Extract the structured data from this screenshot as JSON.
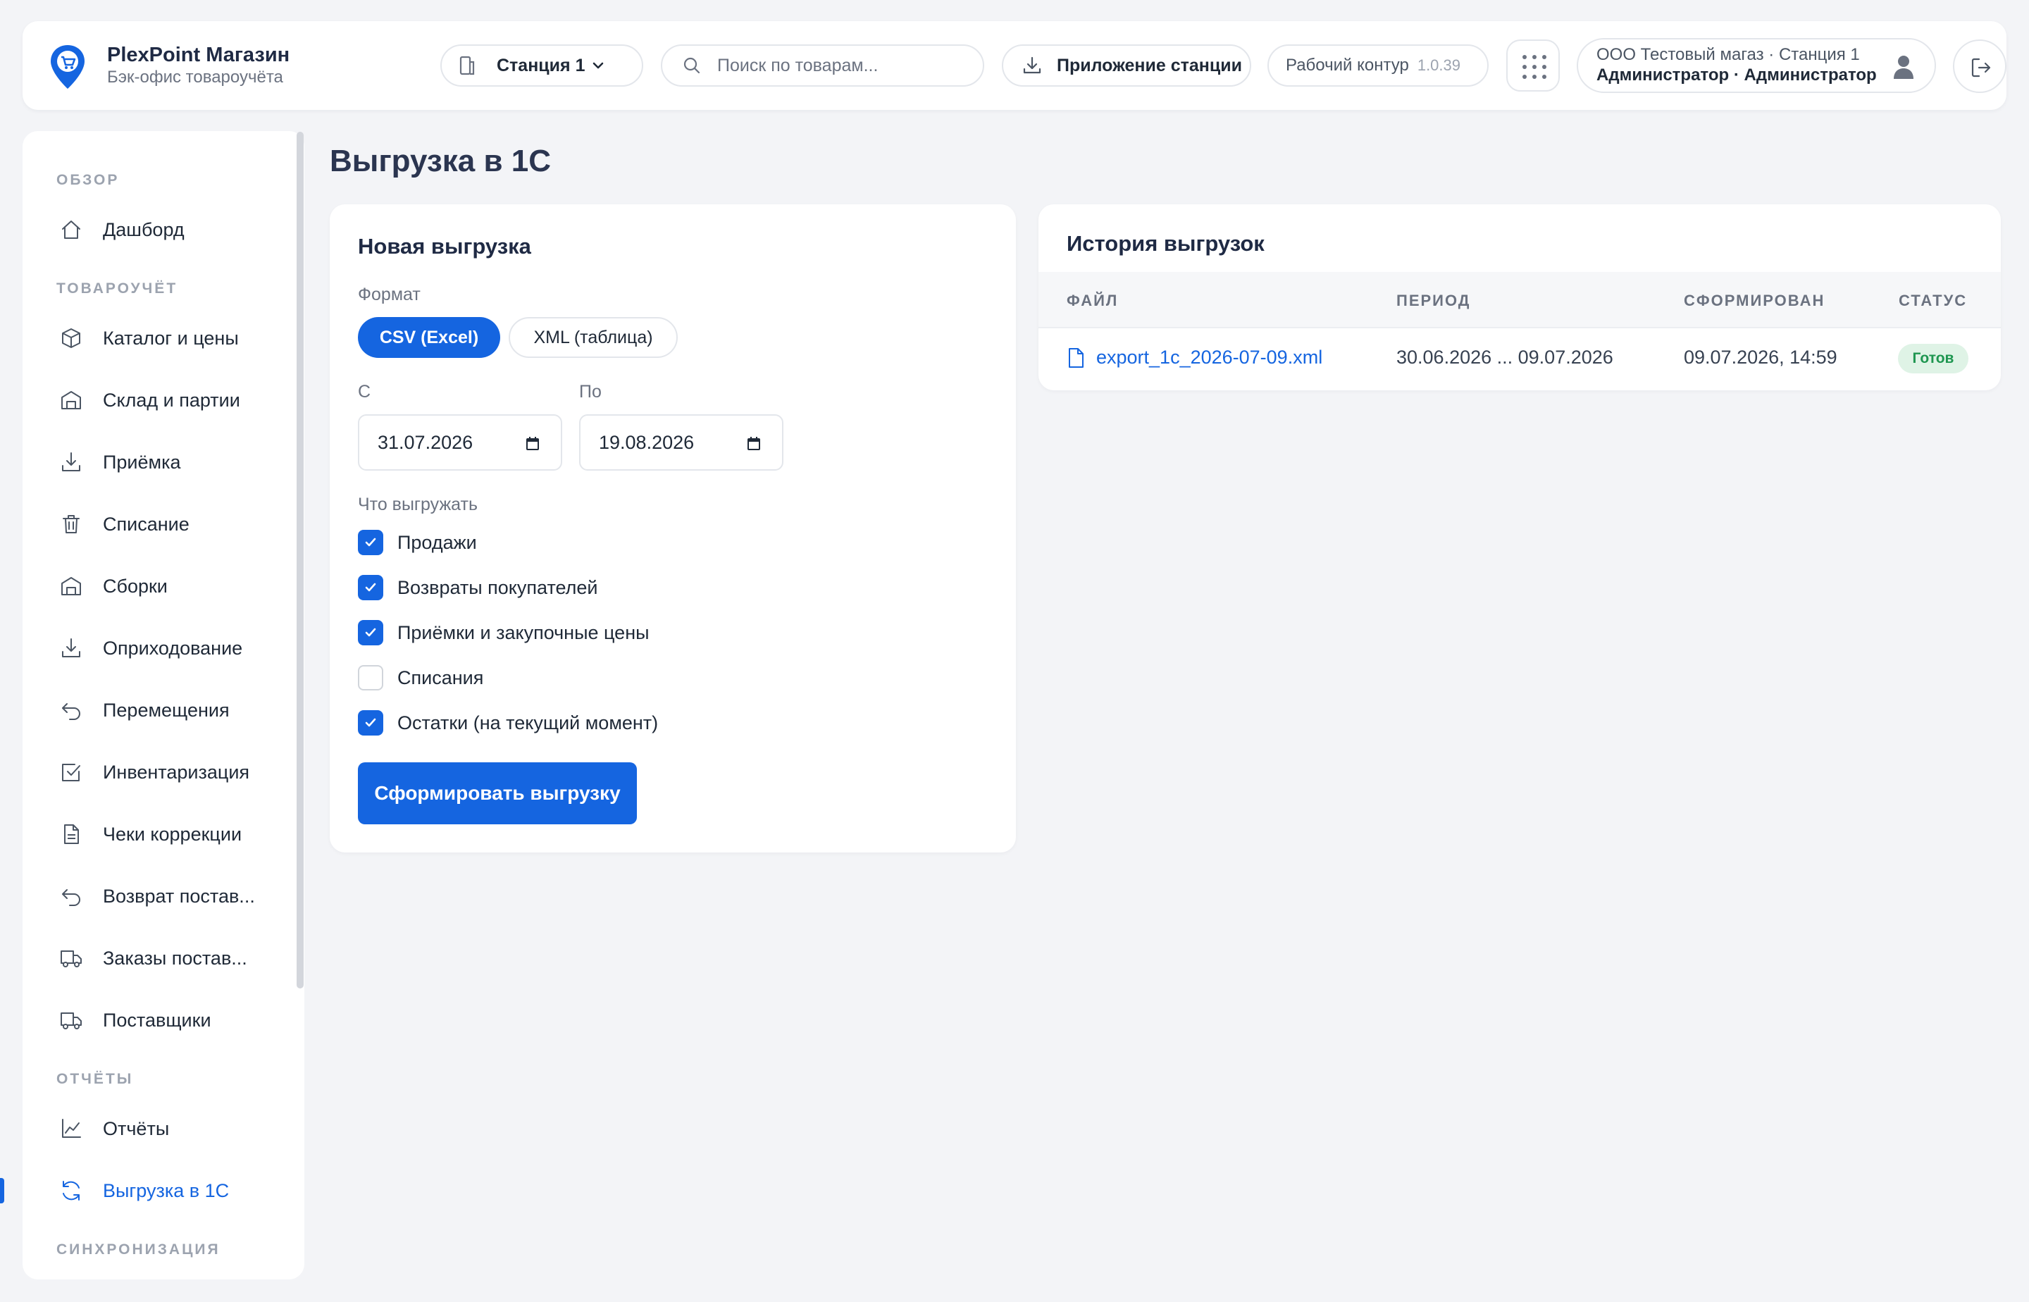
{
  "header": {
    "brand_name": "PlexPoint Магазин",
    "brand_subtitle": "Бэк-офис товароучёта",
    "station_label": "Станция 1",
    "search_placeholder": "Поиск по товарам...",
    "app_button_label": "Приложение станции",
    "env_label": "Рабочий контур",
    "env_version": "1.0.39",
    "user_org_line": "ООО Тестовый магаз · Станция 1",
    "user_role_line": "Администратор · Администратор"
  },
  "sidebar": {
    "sections": {
      "overview": "ОБЗОР",
      "inventory": "ТОВАРОУЧЁТ",
      "reports": "ОТЧЁТЫ",
      "sync": "СИНХРОНИЗАЦИЯ"
    },
    "items": [
      {
        "label": "Дашборд",
        "icon": "home-icon"
      },
      {
        "label": "Каталог и цены",
        "icon": "box-icon"
      },
      {
        "label": "Склад и партии",
        "icon": "warehouse-icon"
      },
      {
        "label": "Приёмка",
        "icon": "download-icon"
      },
      {
        "label": "Списание",
        "icon": "trash-icon"
      },
      {
        "label": "Сборки",
        "icon": "warehouse-icon"
      },
      {
        "label": "Оприходование",
        "icon": "download-icon"
      },
      {
        "label": "Перемещения",
        "icon": "undo-icon"
      },
      {
        "label": "Инвентаризация",
        "icon": "checkbox-icon"
      },
      {
        "label": "Чеки коррекции",
        "icon": "document-icon"
      },
      {
        "label": "Возврат постав...",
        "icon": "undo-icon"
      },
      {
        "label": "Заказы постав...",
        "icon": "truck-icon"
      },
      {
        "label": "Поставщики",
        "icon": "truck-icon"
      },
      {
        "label": "Отчёты",
        "icon": "chart-icon"
      },
      {
        "label": "Выгрузка в 1С",
        "icon": "refresh-icon",
        "active": true
      }
    ]
  },
  "page": {
    "title": "Выгрузка в 1С"
  },
  "new_export": {
    "title": "Новая выгрузка",
    "format_label": "Формат",
    "formats": [
      {
        "label": "CSV (Excel)",
        "selected": true
      },
      {
        "label": "XML (таблица)",
        "selected": false
      }
    ],
    "from_label": "С",
    "to_label": "По",
    "from_value": "31.07.2026",
    "to_value": "19.08.2026",
    "what_label": "Что выгружать",
    "options": [
      {
        "label": "Продажи",
        "checked": true
      },
      {
        "label": "Возвраты покупателей",
        "checked": true
      },
      {
        "label": "Приёмки и закупочные цены",
        "checked": true
      },
      {
        "label": "Списания",
        "checked": false
      },
      {
        "label": "Остатки (на текущий момент)",
        "checked": true
      }
    ],
    "submit_label": "Сформировать выгрузку"
  },
  "history": {
    "title": "История выгрузок",
    "columns": [
      "ФАЙЛ",
      "ПЕРИОД",
      "СФОРМИРОВАН",
      "СТАТУС"
    ],
    "rows": [
      {
        "file": "export_1c_2026-07-09.xml",
        "period": "30.06.2026 ... 09.07.2026",
        "created": "09.07.2026, 14:59",
        "status": "Готов"
      }
    ]
  },
  "colors": {
    "accent": "#1565e0",
    "status_ok_bg": "#dff3e6",
    "status_ok_text": "#1e9650"
  }
}
